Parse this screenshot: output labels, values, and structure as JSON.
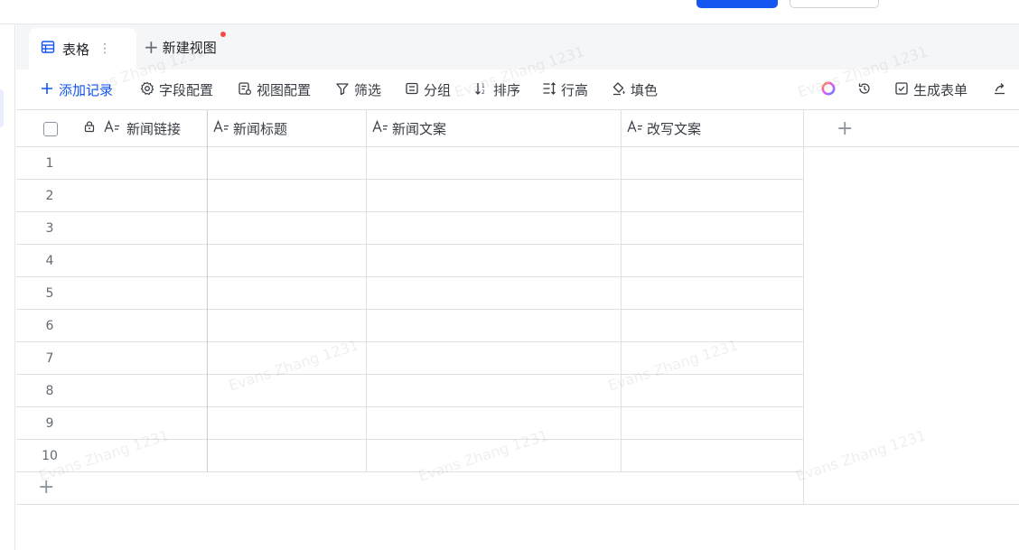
{
  "tabs": {
    "table_label": "表格",
    "more_label": "⋮",
    "new_view_label": "新建视图"
  },
  "toolbar": {
    "add_record": "添加记录",
    "field_config": "字段配置",
    "view_config": "视图配置",
    "filter": "筛选",
    "group": "分组",
    "sort": "排序",
    "row_height": "行高",
    "fill_color": "填色",
    "generate_form": "生成表单"
  },
  "grid": {
    "columns": [
      {
        "label": "新闻链接",
        "locked": true
      },
      {
        "label": "新闻标题",
        "locked": false
      },
      {
        "label": "新闻文案",
        "locked": false
      },
      {
        "label": "改写文案",
        "locked": false
      }
    ],
    "row_numbers": [
      "1",
      "2",
      "3",
      "4",
      "5",
      "6",
      "7",
      "8",
      "9",
      "10"
    ]
  },
  "watermark": "Evans Zhang 1231",
  "colors": {
    "accent": "#1456f0",
    "badge": "#f54a45",
    "tab_bar": "#f5f6f7",
    "border": "#dee0e3"
  }
}
